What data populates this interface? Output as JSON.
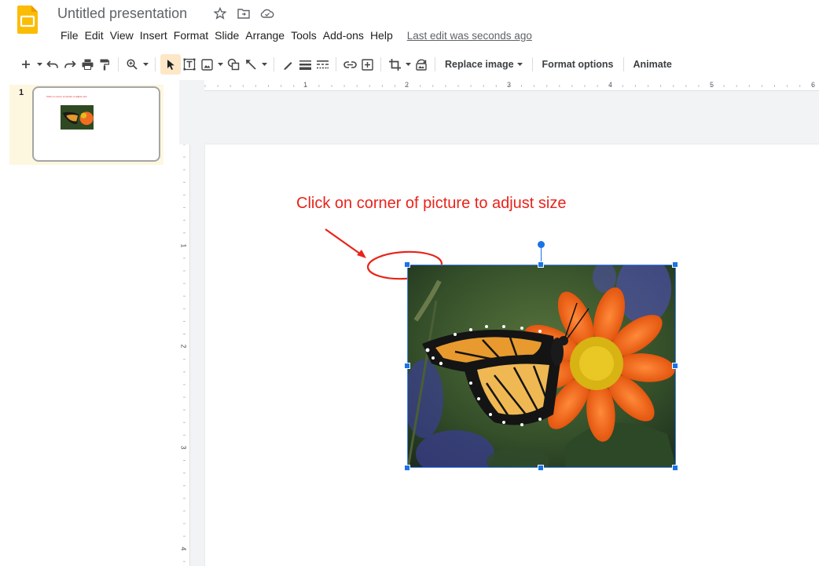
{
  "app": {
    "title": "Untitled presentation",
    "brand_color": "#fbbc04",
    "accent_color": "#1a73e8"
  },
  "menu": {
    "items": [
      "File",
      "Edit",
      "View",
      "Insert",
      "Format",
      "Slide",
      "Arrange",
      "Tools",
      "Add-ons",
      "Help"
    ],
    "last_edit": "Last edit was seconds ago"
  },
  "toolbar": {
    "replace_image": "Replace image",
    "format_options": "Format options",
    "animate": "Animate",
    "icons": [
      "add-icon",
      "undo-icon",
      "redo-icon",
      "print-icon",
      "paint-format-icon",
      "zoom-icon",
      "select-icon",
      "text-box-icon",
      "image-icon",
      "shape-icon",
      "line-icon",
      "pen-icon",
      "line-weight-icon",
      "line-dash-icon",
      "link-icon",
      "comment-icon",
      "crop-icon",
      "reset-image-icon"
    ]
  },
  "filmstrip": {
    "slides": [
      {
        "number": "1"
      }
    ]
  },
  "rulers": {
    "horizontal": [
      "1",
      "2",
      "3",
      "4",
      "5",
      "6"
    ],
    "vertical": [
      "1",
      "2",
      "3",
      "4"
    ]
  },
  "slide": {
    "annotation": "Click on corner of picture to adjust size",
    "annotation_color": "#e8231a"
  }
}
